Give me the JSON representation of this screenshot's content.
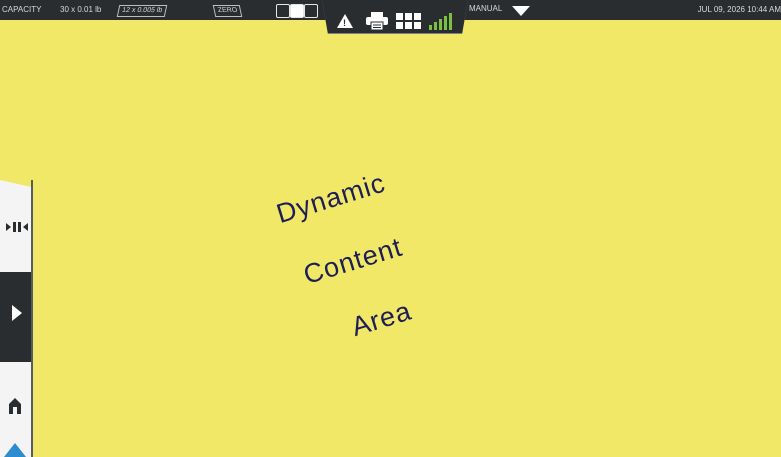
{
  "status_bar": {
    "capacity_label": "CAPACITY",
    "capacity_1": "30 x 0.01 lb",
    "capacity_2": "12 x 0.005 lb",
    "zero_button": "ZERO",
    "mode_label": "MANUAL",
    "datetime": "JUL 09, 2026 10:44 AM"
  },
  "content": {
    "line1": "Dynamic",
    "line2": "Content",
    "line3": "Area"
  },
  "icons": {
    "alert": "warning-icon",
    "printer": "printer-icon",
    "grid": "grid-icon",
    "signal": "signal-icon",
    "mode_dropdown": "chevron-down-icon",
    "side_1": "scale-icon",
    "side_2": "play-icon",
    "side_3": "home-icon"
  },
  "colors": {
    "background": "#f2e868",
    "bar": "#2a2d30",
    "text": "#1e1e56",
    "signal": "#7bc043",
    "accent_blue": "#2b8ccf"
  }
}
